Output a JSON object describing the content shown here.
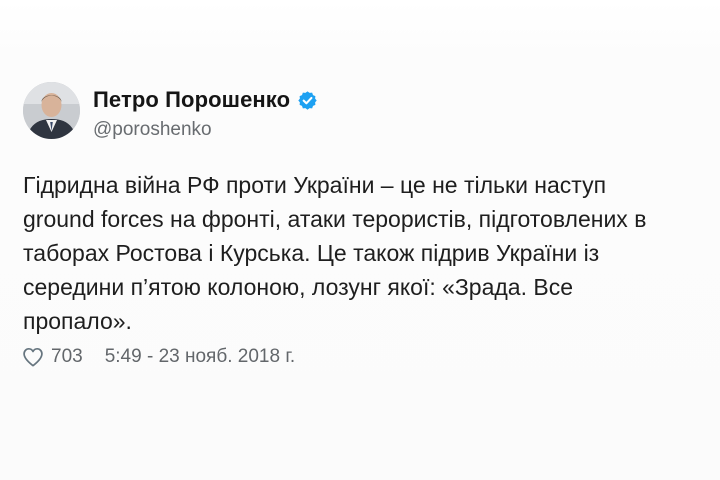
{
  "tweet": {
    "author": {
      "name": "Петро Порошенко",
      "handle": "@poroshenko",
      "verified": true
    },
    "text_lines": [
      "Гідридна війна РФ проти України – це не тільки наступ",
      "ground forces на фронті, атаки терористів, підготовлених в",
      "таборах Ростова і Курська. Це також підрив України із",
      "середини п’ятою колоною, лозунг якої: «Зрада. Все",
      "пропало»."
    ],
    "likes": "703",
    "timestamp": "5:49 - 23 нояб. 2018 г."
  },
  "colors": {
    "verified_badge": "#1da1f2",
    "heart_icon": "#66757f",
    "text": "#1e1e1e",
    "secondary_text": "#686c70"
  },
  "icons": {
    "verified": "verified-badge-icon",
    "like": "heart-icon"
  }
}
